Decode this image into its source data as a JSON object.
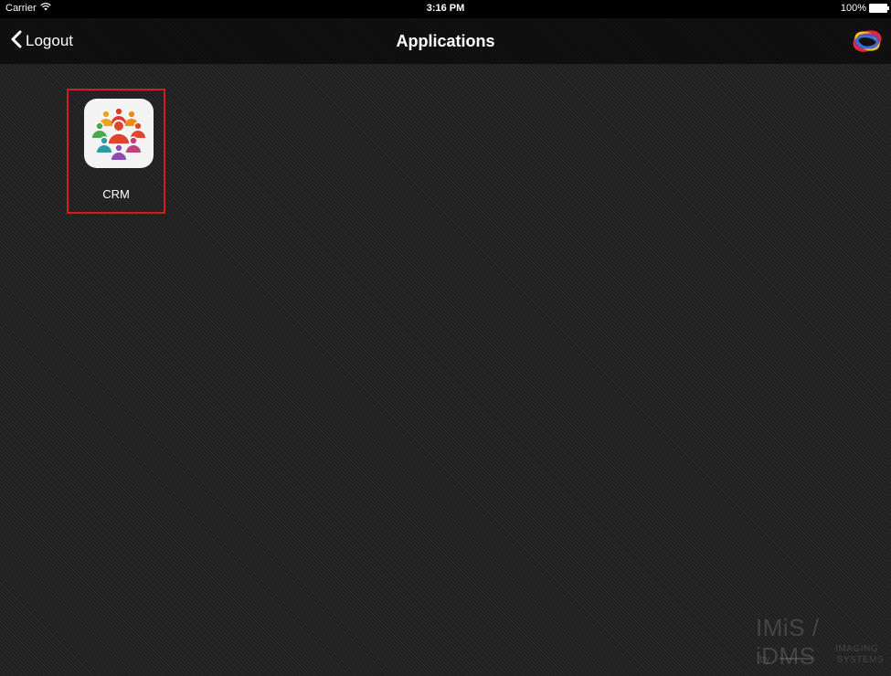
{
  "status_bar": {
    "carrier": "Carrier",
    "time": "3:16 PM",
    "battery": "100%"
  },
  "nav": {
    "back_label": "Logout",
    "title": "Applications"
  },
  "apps": [
    {
      "label": "CRM",
      "icon": "crm-people-icon"
    }
  ],
  "watermark": {
    "title": "IMiS / iDMS",
    "by": "by",
    "company_line1": "IMAGING",
    "company_line2": "SYSTEMS"
  },
  "colors": {
    "selection_border": "#d61a22",
    "nav_text": "#ffffff"
  }
}
